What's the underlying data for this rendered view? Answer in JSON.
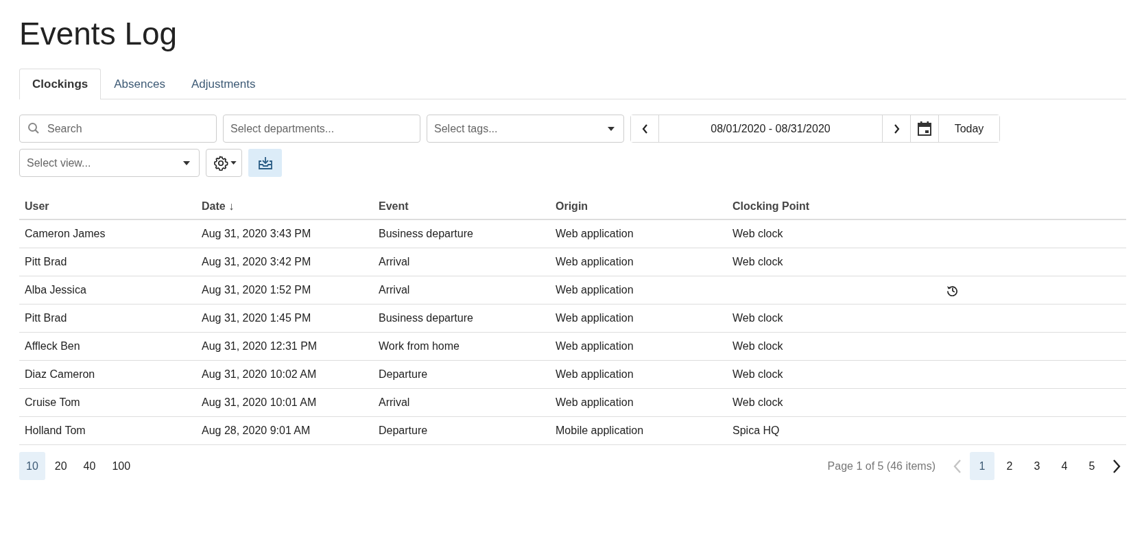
{
  "title": "Events Log",
  "tabs": [
    {
      "label": "Clockings",
      "selected": true
    },
    {
      "label": "Absences",
      "selected": false
    },
    {
      "label": "Adjustments",
      "selected": false
    }
  ],
  "filters": {
    "search": {
      "placeholder": "Search"
    },
    "departments": {
      "placeholder": "Select departments..."
    },
    "tags": {
      "placeholder": "Select tags..."
    },
    "date_range": "08/01/2020 - 08/31/2020",
    "today": "Today",
    "view": {
      "placeholder": "Select view..."
    }
  },
  "table": {
    "columns": [
      "User",
      "Date ↓",
      "Event",
      "Origin",
      "Clocking Point"
    ],
    "rows": [
      {
        "cells": [
          "Cameron James",
          "Aug 31, 2020 3:43 PM",
          "Business departure",
          "Web application",
          "Web clock"
        ],
        "history": false
      },
      {
        "cells": [
          "Pitt Brad",
          "Aug 31, 2020 3:42 PM",
          "Arrival",
          "Web application",
          "Web clock"
        ],
        "history": false
      },
      {
        "cells": [
          "Alba Jessica",
          "Aug 31, 2020 1:52 PM",
          "Arrival",
          "Web application",
          ""
        ],
        "history": true
      },
      {
        "cells": [
          "Pitt Brad",
          "Aug 31, 2020 1:45 PM",
          "Business departure",
          "Web application",
          "Web clock"
        ],
        "history": false
      },
      {
        "cells": [
          "Affleck Ben",
          "Aug 31, 2020 12:31 PM",
          "Work from home",
          "Web application",
          "Web clock"
        ],
        "history": false
      },
      {
        "cells": [
          "Diaz Cameron",
          "Aug 31, 2020 10:02 AM",
          "Departure",
          "Web application",
          "Web clock"
        ],
        "history": false
      },
      {
        "cells": [
          "Cruise Tom",
          "Aug 31, 2020 10:01 AM",
          "Arrival",
          "Web application",
          "Web clock"
        ],
        "history": false
      },
      {
        "cells": [
          "Holland Tom",
          "Aug 28, 2020 9:01 AM",
          "Departure",
          "Mobile application",
          "Spica HQ"
        ],
        "history": false
      }
    ]
  },
  "pagination": {
    "page_sizes": [
      {
        "label": "10",
        "selected": true
      },
      {
        "label": "20",
        "selected": false
      },
      {
        "label": "40",
        "selected": false
      },
      {
        "label": "100",
        "selected": false
      }
    ],
    "summary": "Page 1 of 5 (46 items)",
    "previous_disabled": true,
    "next_disabled": false,
    "pages": [
      {
        "label": "1",
        "selected": true
      },
      {
        "label": "2",
        "selected": false
      },
      {
        "label": "3",
        "selected": false
      },
      {
        "label": "4",
        "selected": false
      },
      {
        "label": "5",
        "selected": false
      }
    ]
  }
}
